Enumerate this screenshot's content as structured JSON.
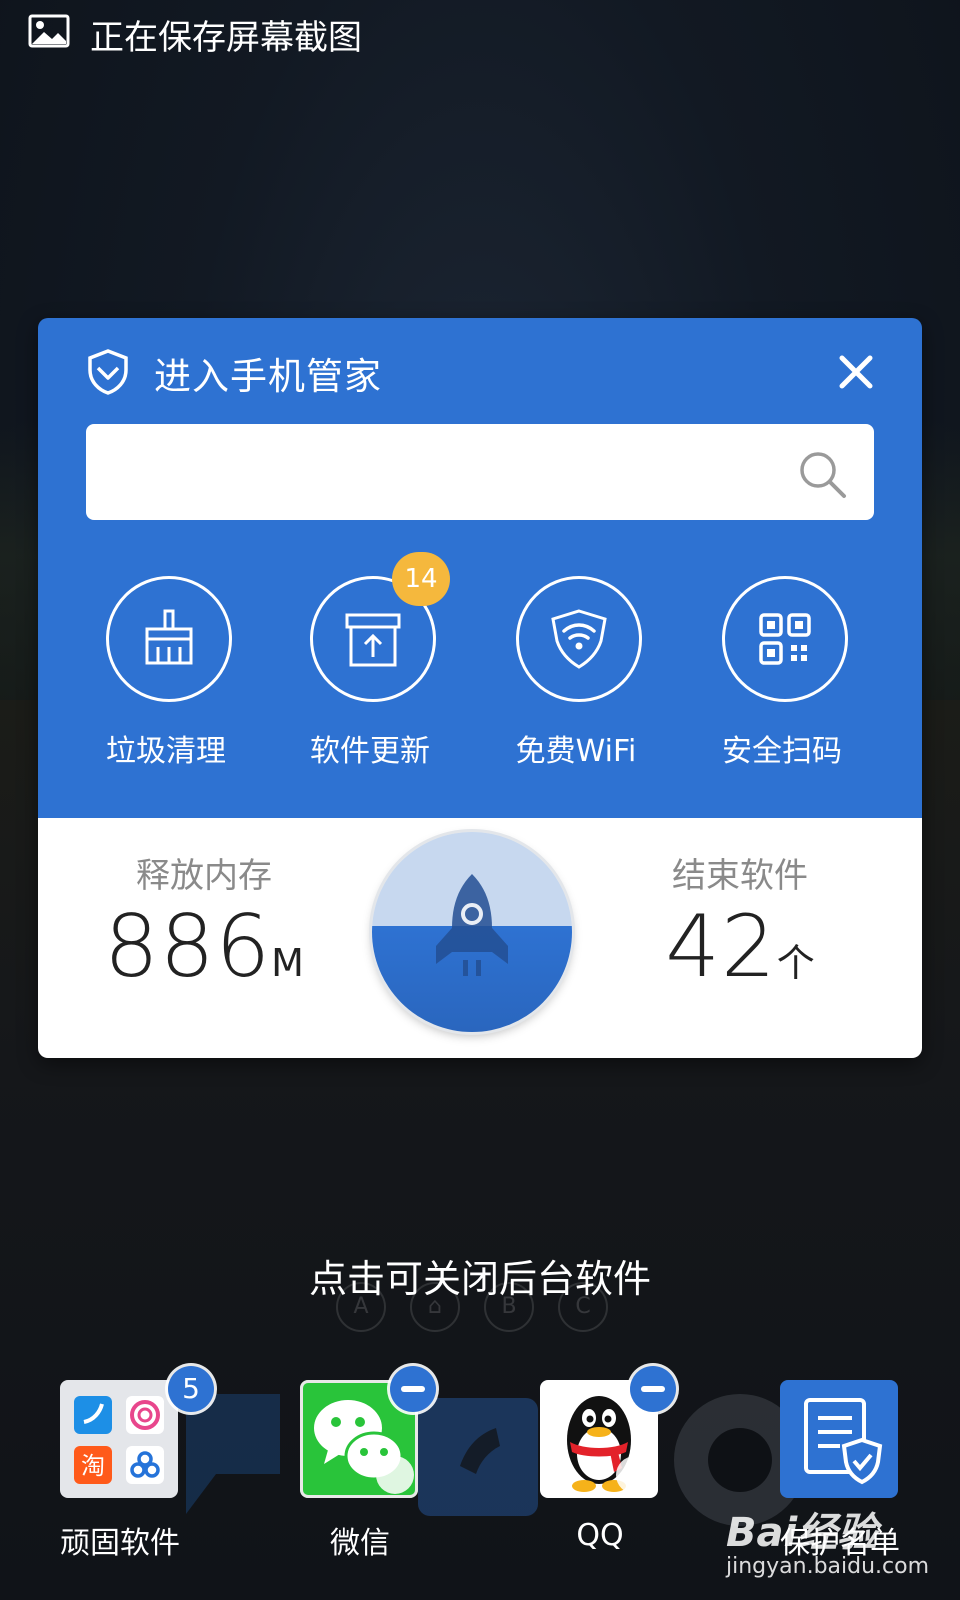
{
  "statusbar": {
    "text": "正在保存屏幕截图",
    "icon": "image-icon"
  },
  "panel": {
    "title": "进入手机管家",
    "search": {
      "value": "",
      "placeholder": ""
    },
    "tools": [
      {
        "label": "垃圾清理",
        "icon": "broom-icon"
      },
      {
        "label": "软件更新",
        "icon": "box-upload-icon",
        "badge": "14"
      },
      {
        "label": "免费WiFi",
        "icon": "wifi-shield-icon"
      },
      {
        "label": "安全扫码",
        "icon": "qr-code-icon"
      }
    ],
    "stats": {
      "memory": {
        "label": "释放内存",
        "value": "886",
        "unit": "M"
      },
      "apps": {
        "label": "结束软件",
        "value": "42",
        "unit": "个"
      }
    },
    "accent": "#2e72d2",
    "badge_color": "#f5b83d"
  },
  "hint": "点击可关闭后台软件",
  "page_dots": [
    "A",
    "⌂",
    "B",
    "C"
  ],
  "dock": [
    {
      "name": "顽固软件",
      "badge": "5"
    },
    {
      "name": "微信"
    },
    {
      "name": "QQ"
    },
    {
      "name": "保护名单"
    }
  ],
  "watermark": {
    "line1": "Bai经验",
    "line2": "jingyan.baidu.com"
  }
}
